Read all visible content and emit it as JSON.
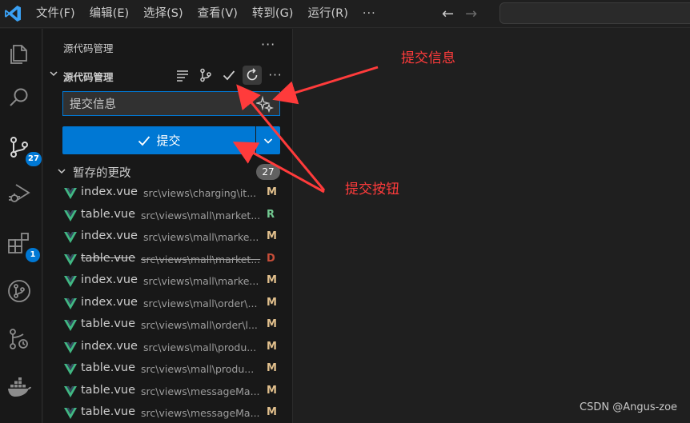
{
  "menu": {
    "items": [
      "文件(F)",
      "编辑(E)",
      "选择(S)",
      "查看(V)",
      "转到(G)",
      "运行(R)"
    ],
    "more": "···",
    "back_icon": "arrow-left-icon",
    "forward_icon": "arrow-right-icon"
  },
  "activity_bar": {
    "items": [
      {
        "icon": "explorer-icon"
      },
      {
        "icon": "search-icon"
      },
      {
        "icon": "source-control-icon",
        "badge": "27"
      },
      {
        "icon": "run-debug-icon"
      },
      {
        "icon": "extensions-icon",
        "badge": "1"
      },
      {
        "icon": "git-graph-icon"
      },
      {
        "icon": "git-history-icon"
      },
      {
        "icon": "docker-icon"
      }
    ]
  },
  "sidebar": {
    "title": "源代码管理",
    "title_more": "···",
    "repo": {
      "label": "源代码管理",
      "more": "···"
    },
    "commit_input": {
      "value": "提交信息",
      "placeholder": ""
    },
    "commit_button": {
      "label": "提交"
    },
    "staged": {
      "label": "暂存的更改",
      "count": "27"
    },
    "files": [
      {
        "name": "index.vue",
        "path": "src\\views\\charging\\it...",
        "status": "M"
      },
      {
        "name": "table.vue",
        "path": "src\\views\\mall\\market...",
        "status": "R"
      },
      {
        "name": "index.vue",
        "path": "src\\views\\mall\\marke...",
        "status": "M"
      },
      {
        "name": "table.vue",
        "path": "src\\views\\mall\\market...",
        "status": "D"
      },
      {
        "name": "index.vue",
        "path": "src\\views\\mall\\marke...",
        "status": "M"
      },
      {
        "name": "index.vue",
        "path": "src\\views\\mall\\order\\...",
        "status": "M"
      },
      {
        "name": "table.vue",
        "path": "src\\views\\mall\\order\\l...",
        "status": "M"
      },
      {
        "name": "index.vue",
        "path": "src\\views\\mall\\produ...",
        "status": "M"
      },
      {
        "name": "table.vue",
        "path": "src\\views\\mall\\produ...",
        "status": "M"
      },
      {
        "name": "table.vue",
        "path": "src\\views\\messageMa...",
        "status": "M"
      },
      {
        "name": "table.vue",
        "path": "src\\views\\messageMa...",
        "status": "M"
      }
    ]
  },
  "annotations": {
    "commit_message_label": "提交信息",
    "commit_button_label": "提交按钮"
  },
  "watermark": "CSDN @Angus-zoe",
  "colors": {
    "accent": "#0078d4",
    "annotation": "#ff3b3b",
    "status_modified": "#e2c08d",
    "status_renamed": "#73c991",
    "status_deleted": "#c74e39",
    "vue_green": "#41b883"
  }
}
